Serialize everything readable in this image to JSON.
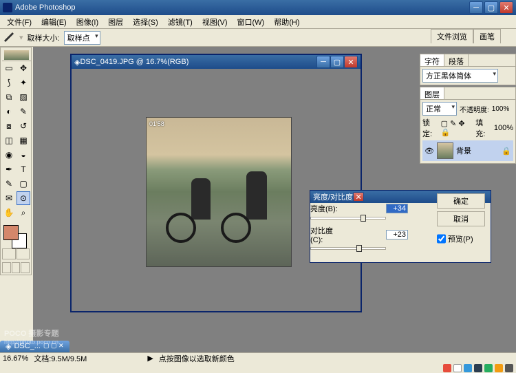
{
  "app": {
    "title": "Adobe Photoshop"
  },
  "menu": [
    "文件(F)",
    "编辑(E)",
    "图像(I)",
    "图层",
    "选择(S)",
    "滤镜(T)",
    "视图(V)",
    "窗口(W)",
    "帮助(H)"
  ],
  "options": {
    "sample_label": "取样大小:",
    "sample_value": "取样点"
  },
  "right_tabs": [
    "文件浏览",
    "画笔"
  ],
  "document": {
    "title": "DSC_0419.JPG @ 16.7%(RGB)",
    "stamp": "01'58"
  },
  "dialog": {
    "title": "亮度/对比度",
    "brightness_label": "亮度(B):",
    "brightness_value": "+34",
    "contrast_label": "对比度(C):",
    "contrast_value": "+23",
    "ok": "确定",
    "cancel": "取消",
    "preview": "预览(P)"
  },
  "panels": {
    "char_tabs": [
      "字符",
      "段落"
    ],
    "font": "方正黑体简体",
    "layer_tab": "图层",
    "blend": "正常",
    "opacity_label": "不透明度:",
    "opacity": "100%",
    "lock_label": "锁定:",
    "fill_label": "填充:",
    "fill": "100%",
    "bg_layer": "背景"
  },
  "status": {
    "zoom": "16.67%",
    "docsize": "文档:9.5M/9.5M",
    "hint": "点按图像以选取新颜色"
  },
  "filetab": "DSC_...",
  "watermark": {
    "main": "POCO 摄影专题",
    "sub": "http://photo.poco.cn"
  },
  "icons": {
    "marquee": "▭",
    "move": "✥",
    "lasso": "⟆",
    "wand": "✦",
    "crop": "⧉",
    "slice": "▨",
    "heal": "◐",
    "brush": "✎",
    "stamp": "⧇",
    "history": "↺",
    "eraser": "◫",
    "grad": "▦",
    "blur": "◉",
    "dodge": "◒",
    "path": "✒",
    "type": "T",
    "pen": "✎",
    "shape": "▢",
    "notes": "✉",
    "eye": "⊙",
    "hand": "✋",
    "zoom": "⌕"
  }
}
